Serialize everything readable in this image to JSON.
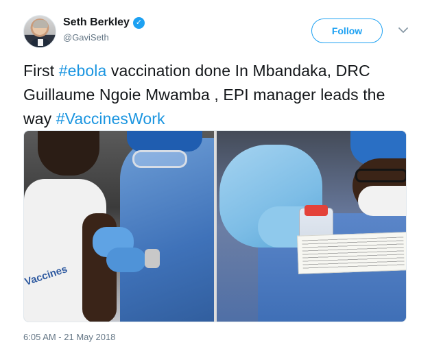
{
  "author": {
    "display_name": "Seth Berkley",
    "handle": "@GaviSeth",
    "verified_icon": "verified-badge-icon",
    "avatar": "avatar"
  },
  "header": {
    "follow_label": "Follow",
    "caret_icon": "chevron-down-icon"
  },
  "tweet": {
    "text_parts": {
      "p1": "First ",
      "h1": "#ebola",
      "p2": " vaccination done In Mbandaka, DRC Guillaume Ngoie Mwamba , EPI manager leads the way ",
      "h2": "#VaccinesWork"
    }
  },
  "media": {
    "left_photo_text": "Vaccines"
  },
  "footer": {
    "timestamp": "6:05 AM - 21 May 2018"
  },
  "colors": {
    "link_blue": "#1b95e0",
    "follow_blue": "#1da1f2",
    "text": "#14171a",
    "muted": "#657786"
  }
}
